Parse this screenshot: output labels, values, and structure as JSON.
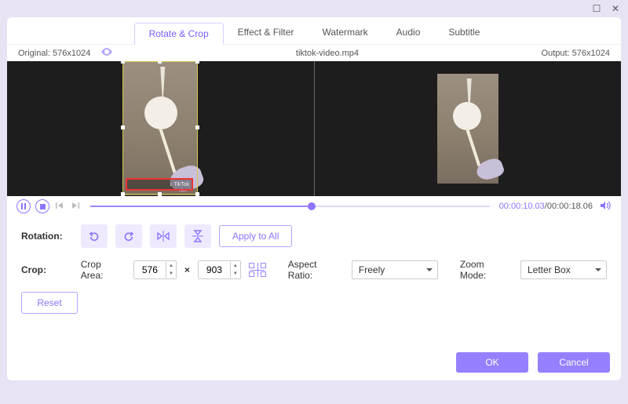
{
  "window": {
    "maximize": "☐",
    "close": "✕"
  },
  "tabs": [
    "Rotate & Crop",
    "Effect & Filter",
    "Watermark",
    "Audio",
    "Subtitle"
  ],
  "active_tab": 0,
  "infobar": {
    "original_label": "Original: 576x1024",
    "filename": "tiktok-video.mp4",
    "output_label": "Output: 576x1024"
  },
  "playback": {
    "current": "00:00:10.03",
    "total": "00:00:18.06",
    "progress_pct": 55.5
  },
  "rotation": {
    "label": "Rotation:",
    "apply_all": "Apply to All"
  },
  "crop": {
    "label": "Crop:",
    "area_label": "Crop Area:",
    "w": "576",
    "h": "903",
    "aspect_label": "Aspect Ratio:",
    "aspect_value": "Freely",
    "zoom_label": "Zoom Mode:",
    "zoom_value": "Letter Box",
    "reset": "Reset"
  },
  "footer": {
    "ok": "OK",
    "cancel": "Cancel"
  },
  "watermark_text": "♪ TikTok"
}
